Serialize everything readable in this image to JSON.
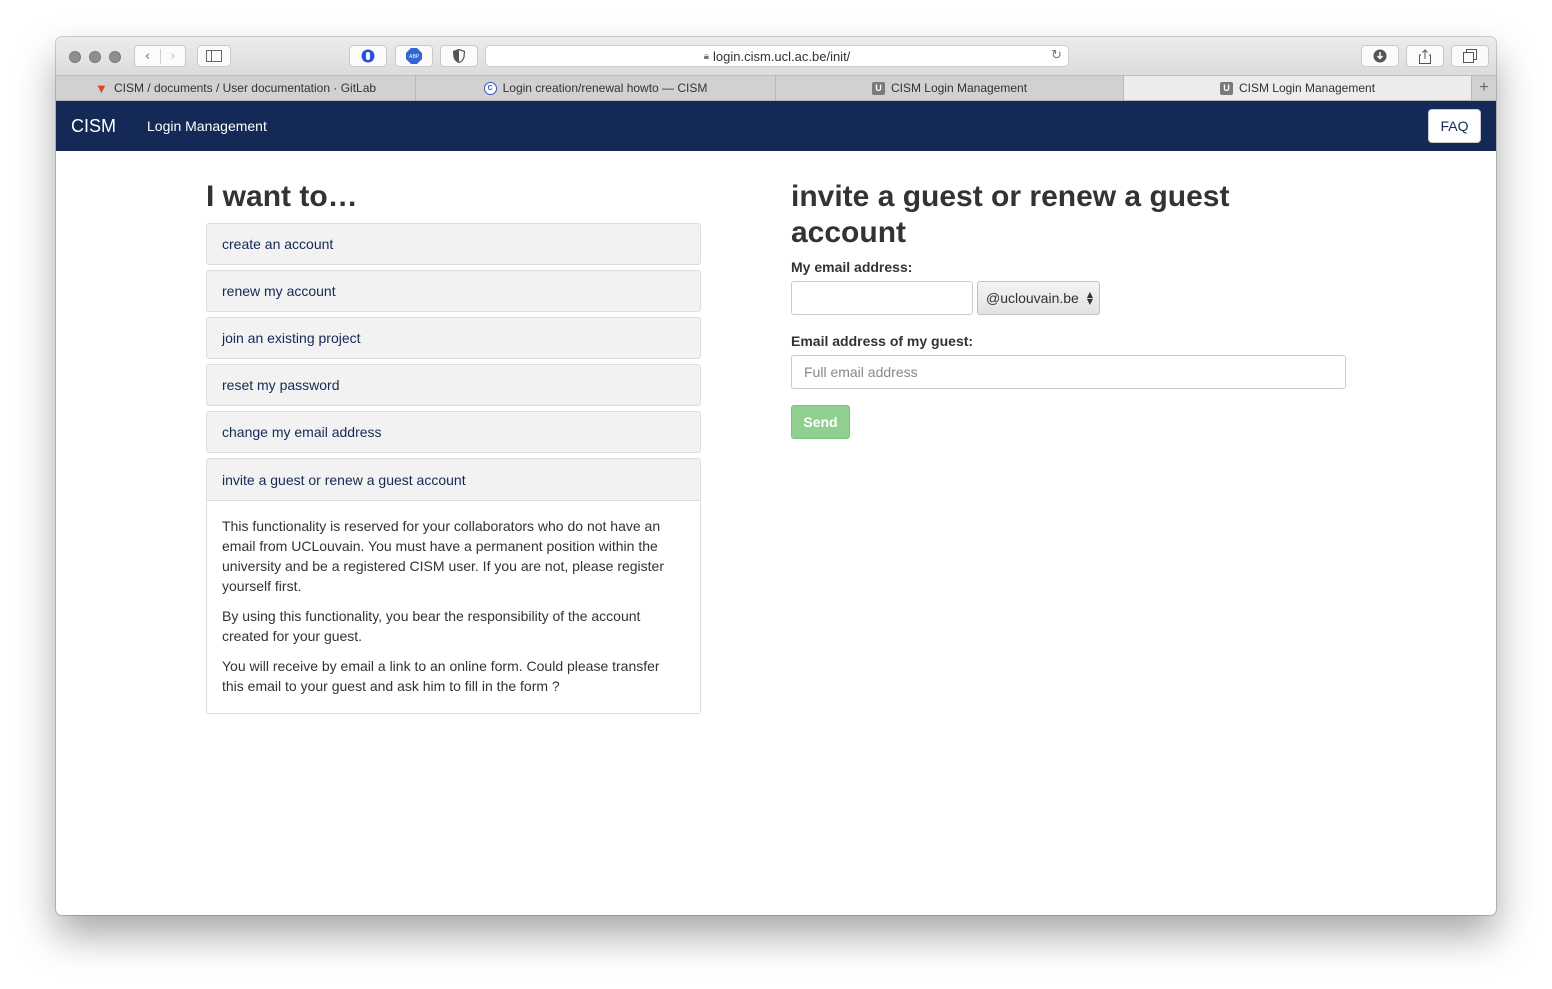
{
  "browser": {
    "url": "login.cism.ucl.ac.be/init/",
    "tabs": [
      {
        "label": "CISM / documents / User documentation · GitLab",
        "favicon": "gitlab-icon"
      },
      {
        "label": "Login creation/renewal howto — CISM",
        "favicon": "cism-icon"
      },
      {
        "label": "CISM Login Management",
        "favicon": "U"
      },
      {
        "label": "CISM Login Management",
        "favicon": "U"
      }
    ],
    "new_tab_label": "+"
  },
  "navbar": {
    "brand": "CISM",
    "link": "Login Management",
    "faq_label": "FAQ",
    "background": "#142955"
  },
  "left": {
    "heading": "I want to…",
    "items": [
      {
        "label": "create an account"
      },
      {
        "label": "renew my account"
      },
      {
        "label": "join an existing project"
      },
      {
        "label": "reset my password"
      },
      {
        "label": "change my email address"
      }
    ],
    "active_item": {
      "label": "invite a guest or renew a guest account",
      "paragraphs": [
        "This functionality is reserved for your collaborators who do not have an email from UCLouvain. You must have a permanent position within the university and be a registered CISM user. If you are not, please register yourself first.",
        "By using this functionality, you bear the responsibility of the account created for your guest.",
        "You will receive by email a link to an online form. Could please transfer this email to your guest and ask him to fill in the form ?"
      ]
    }
  },
  "form": {
    "heading": "invite a guest or renew a guest account",
    "my_email_label": "My email address:",
    "my_email_value": "",
    "domain_selected": "@uclouvain.be",
    "guest_email_label": "Email address of my guest:",
    "guest_email_placeholder": "Full email address",
    "send_label": "Send",
    "send_color": "#8fcf8f"
  }
}
